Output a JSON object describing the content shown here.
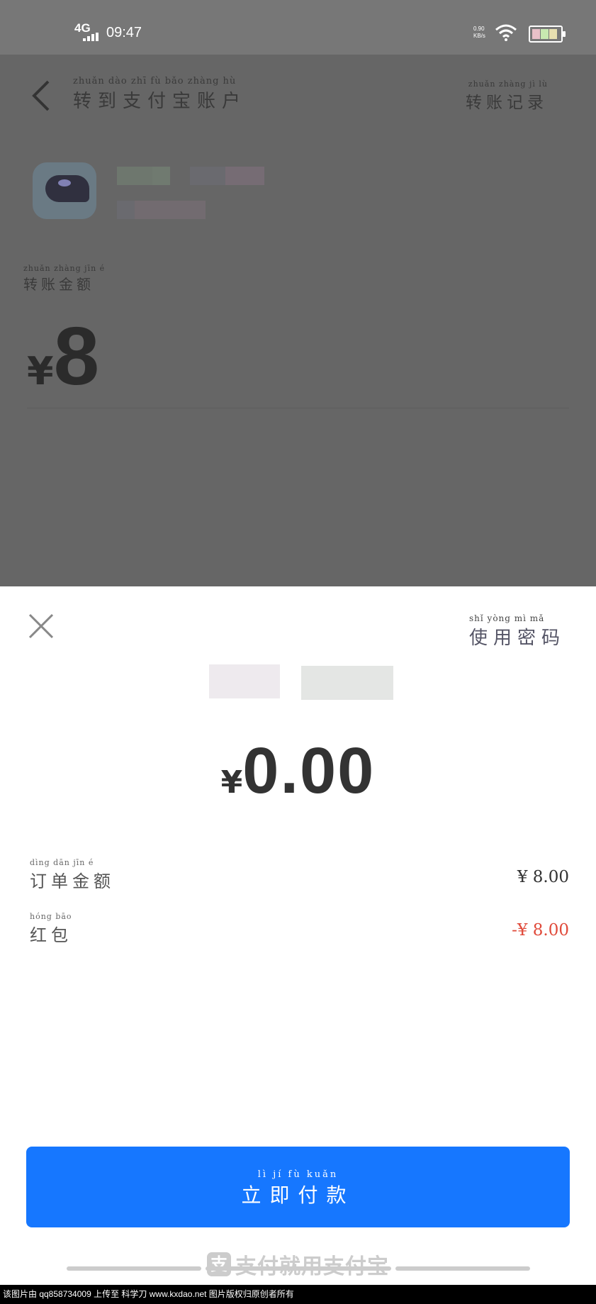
{
  "status_bar": {
    "network": "4G",
    "time": "09:47",
    "speed_value": "0.90",
    "speed_unit": "KB/s"
  },
  "header": {
    "title_pinyin": "zhuǎn dào zhī fù bǎo zhàng hù",
    "title": "转到支付宝账户",
    "record_pinyin": "zhuǎn zhàng jì lù",
    "record": "转账记录"
  },
  "transfer": {
    "amount_label_pinyin": "zhuǎn zhàng jīn é",
    "amount_label": "转账金额",
    "currency": "¥",
    "amount": "8"
  },
  "sheet": {
    "use_password_pinyin": "shǐ yòng mì mǎ",
    "use_password": "使用密码",
    "pay_currency": "¥",
    "pay_amount": "0.00",
    "order_label_pinyin": "dìng dān jīn é",
    "order_label": "订单金额",
    "order_value": "¥ 8.00",
    "redpacket_label_pinyin": "hóng bāo",
    "redpacket_label": "红包",
    "redpacket_value": "-¥ 8.00",
    "pay_button_pinyin": "lì jí fù kuǎn",
    "pay_button": "立即付款",
    "brand": "支付就用支付宝"
  },
  "watermark": "该图片由 qq858734009 上传至 科学刀 www.kxdao.net 图片版权归原创者所有",
  "colors": {
    "accent": "#1677ff",
    "red": "#e04a3a",
    "overlay": "#666666"
  }
}
